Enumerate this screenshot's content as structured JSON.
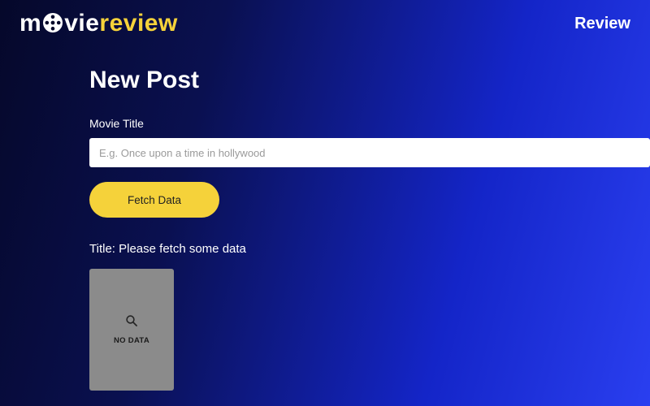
{
  "logo": {
    "part1": "m",
    "part2": "vie",
    "part3": "review"
  },
  "nav": {
    "review_link": "Review"
  },
  "main": {
    "heading": "New Post",
    "movie_title_label": "Movie Title",
    "movie_title_placeholder": "E.g. Once upon a time in hollywood",
    "movie_title_value": "",
    "fetch_button": "Fetch Data",
    "status_prefix": "Title: ",
    "status_value": "Please fetch some data",
    "no_data_label": "NO DATA"
  }
}
